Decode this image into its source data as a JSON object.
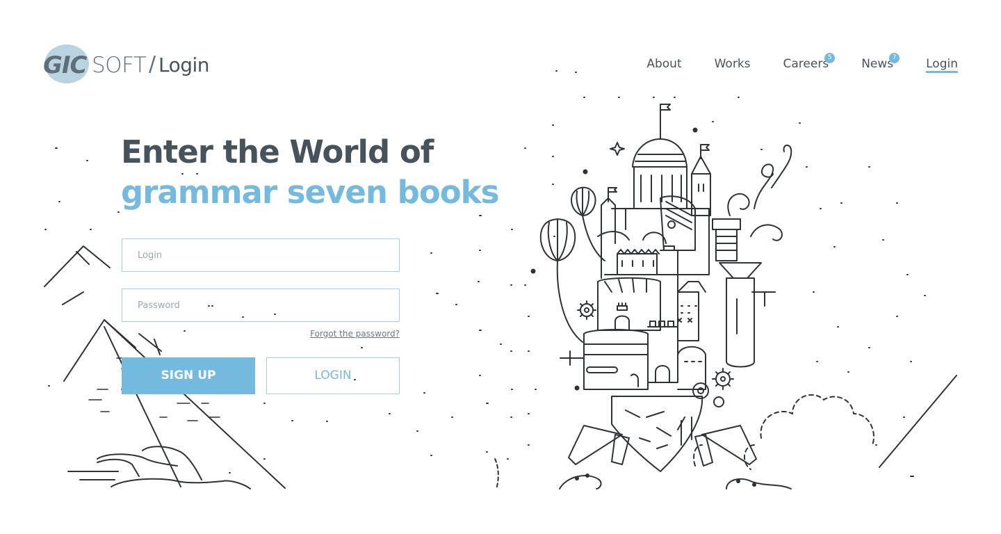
{
  "logo": {
    "brand_bold": "GIC",
    "brand_light": "SOFT",
    "separator": "/",
    "page_name": "Login",
    "accent_color": "#b9d3e0"
  },
  "nav": {
    "items": [
      {
        "label": "About",
        "badge": null
      },
      {
        "label": "Works",
        "badge": null
      },
      {
        "label": "Careers",
        "badge": "5"
      },
      {
        "label": "News",
        "badge": "7"
      },
      {
        "label": "Login",
        "badge": null,
        "active": true
      }
    ],
    "accent_color": "#74b9de"
  },
  "hero": {
    "line1": "Enter the World of",
    "line2": "grammar seven books"
  },
  "form": {
    "login_placeholder": "Login",
    "login_value": "",
    "password_placeholder": "Password",
    "password_value": "",
    "forgot_label": "Forgot the password?",
    "signup_label": "SIGN UP",
    "login_label": "LOGIN"
  },
  "illustration": {
    "left": "mountain-landscape-icon",
    "right": "floating-castle-island-icon"
  },
  "colors": {
    "text": "#46535c",
    "accent": "#74b9de",
    "line_art": "#2d3237"
  }
}
